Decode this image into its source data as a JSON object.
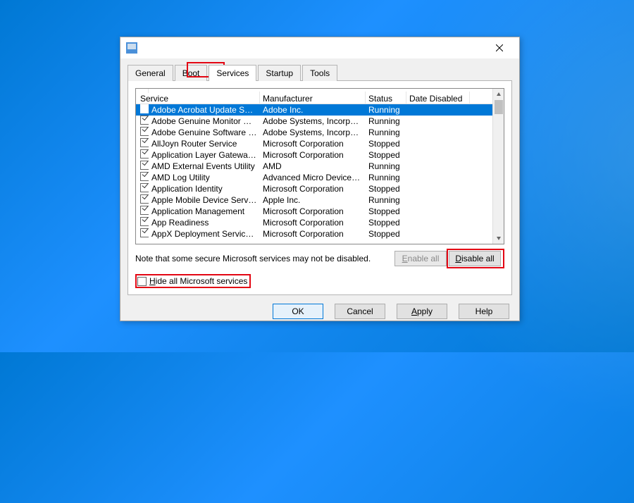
{
  "tabs": [
    {
      "label": "General"
    },
    {
      "label": "Boot"
    },
    {
      "label": "Services"
    },
    {
      "label": "Startup"
    },
    {
      "label": "Tools"
    }
  ],
  "activeTab": 2,
  "columns": [
    "Service",
    "Manufacturer",
    "Status",
    "Date Disabled"
  ],
  "rows": [
    {
      "checked": true,
      "service": "Adobe Acrobat Update Service",
      "manufacturer": "Adobe Inc.",
      "status": "Running",
      "dateDisabled": "",
      "selected": true
    },
    {
      "checked": true,
      "service": "Adobe Genuine Monitor Service",
      "manufacturer": "Adobe Systems, Incorpora...",
      "status": "Running",
      "dateDisabled": ""
    },
    {
      "checked": true,
      "service": "Adobe Genuine Software Integri...",
      "manufacturer": "Adobe Systems, Incorpora...",
      "status": "Running",
      "dateDisabled": ""
    },
    {
      "checked": true,
      "service": "AllJoyn Router Service",
      "manufacturer": "Microsoft Corporation",
      "status": "Stopped",
      "dateDisabled": ""
    },
    {
      "checked": true,
      "service": "Application Layer Gateway Service",
      "manufacturer": "Microsoft Corporation",
      "status": "Stopped",
      "dateDisabled": ""
    },
    {
      "checked": true,
      "service": "AMD External Events Utility",
      "manufacturer": "AMD",
      "status": "Running",
      "dateDisabled": ""
    },
    {
      "checked": true,
      "service": "AMD Log Utility",
      "manufacturer": "Advanced Micro Devices, I...",
      "status": "Running",
      "dateDisabled": ""
    },
    {
      "checked": true,
      "service": "Application Identity",
      "manufacturer": "Microsoft Corporation",
      "status": "Stopped",
      "dateDisabled": ""
    },
    {
      "checked": true,
      "service": "Apple Mobile Device Service",
      "manufacturer": "Apple Inc.",
      "status": "Running",
      "dateDisabled": ""
    },
    {
      "checked": true,
      "service": "Application Management",
      "manufacturer": "Microsoft Corporation",
      "status": "Stopped",
      "dateDisabled": ""
    },
    {
      "checked": true,
      "service": "App Readiness",
      "manufacturer": "Microsoft Corporation",
      "status": "Stopped",
      "dateDisabled": ""
    },
    {
      "checked": true,
      "service": "AppX Deployment Service (AppX...",
      "manufacturer": "Microsoft Corporation",
      "status": "Stopped",
      "dateDisabled": ""
    }
  ],
  "noteText": "Note that some secure Microsoft services may not be disabled.",
  "buttons": {
    "enableAll": "Enable all",
    "disableAll": "Disable all",
    "hideLabel": "Hide all Microsoft services",
    "ok": "OK",
    "cancel": "Cancel",
    "apply": "Apply",
    "help": "Help"
  }
}
